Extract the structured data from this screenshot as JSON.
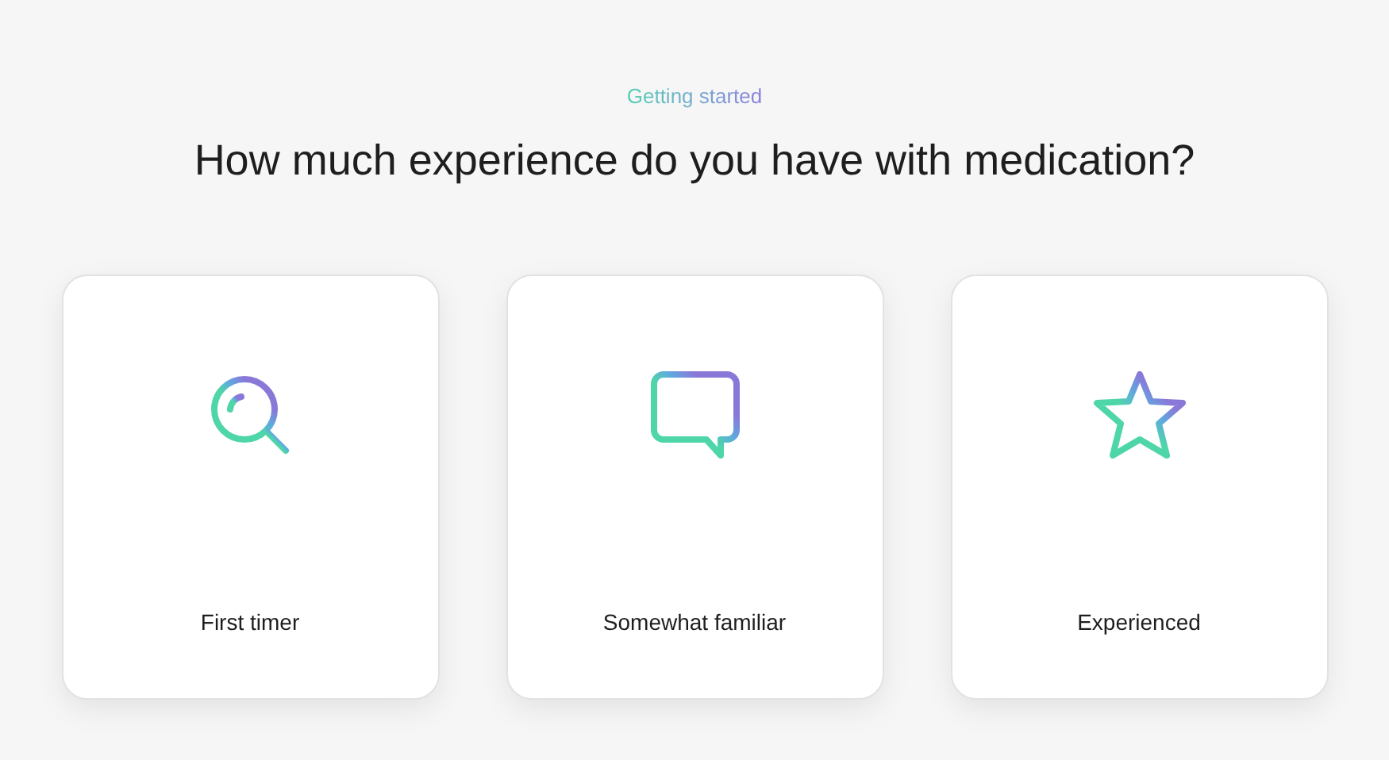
{
  "eyebrow": "Getting started",
  "title": "How much experience do you have with medication?",
  "options": [
    {
      "kind": "search",
      "label": "First timer"
    },
    {
      "kind": "chat",
      "label": "Somewhat familiar"
    },
    {
      "kind": "star",
      "label": "Experienced"
    }
  ]
}
